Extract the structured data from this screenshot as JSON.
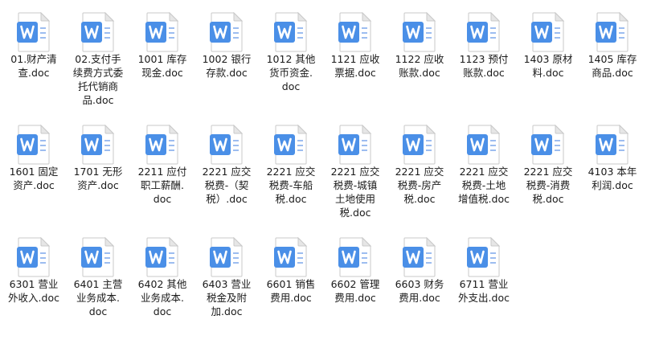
{
  "files": [
    {
      "line1": "01.财产清",
      "line2": "查.doc",
      "line3": ""
    },
    {
      "line1": "02.支付手",
      "line2": "续费方式委",
      "line3": "托代销商",
      "line4": "品.doc"
    },
    {
      "line1": "1001 库存",
      "line2": "现金.doc",
      "line3": ""
    },
    {
      "line1": "1002 银行",
      "line2": "存款.doc",
      "line3": ""
    },
    {
      "line1": "1012 其他",
      "line2": "货币资金.",
      "line3": "doc"
    },
    {
      "line1": "1121 应收",
      "line2": "票据.doc",
      "line3": ""
    },
    {
      "line1": "1122 应收",
      "line2": "账款.doc",
      "line3": ""
    },
    {
      "line1": "1123 预付",
      "line2": "账款.doc",
      "line3": ""
    },
    {
      "line1": "1403 原材",
      "line2": "料.doc",
      "line3": ""
    },
    {
      "line1": "1405 库存",
      "line2": "商品.doc",
      "line3": ""
    },
    {
      "line1": "1601 固定",
      "line2": "资产.doc",
      "line3": ""
    },
    {
      "line1": "1701 无形",
      "line2": "资产.doc",
      "line3": ""
    },
    {
      "line1": "2211 应付",
      "line2": "职工薪酬.",
      "line3": "doc"
    },
    {
      "line1": "2221 应交",
      "line2": "税费-（契",
      "line3": "税）.doc"
    },
    {
      "line1": "2221 应交",
      "line2": "税费-车船",
      "line3": "税.doc"
    },
    {
      "line1": "2221 应交",
      "line2": "税费-城镇",
      "line3": "土地使用",
      "line4": "税.doc"
    },
    {
      "line1": "2221 应交",
      "line2": "税费-房产",
      "line3": "税.doc"
    },
    {
      "line1": "2221 应交",
      "line2": "税费-土地",
      "line3": "增值税.doc"
    },
    {
      "line1": "2221 应交",
      "line2": "税费-消费",
      "line3": "税.doc"
    },
    {
      "line1": "4103 本年",
      "line2": "利润.doc",
      "line3": ""
    },
    {
      "line1": "6301 营业",
      "line2": "外收入.doc",
      "line3": ""
    },
    {
      "line1": "6401 主营",
      "line2": "业务成本.",
      "line3": "doc"
    },
    {
      "line1": "6402  其他",
      "line2": "业务成本.",
      "line3": "doc"
    },
    {
      "line1": "6403 营业",
      "line2": "税金及附",
      "line3": "加.doc"
    },
    {
      "line1": "6601 销售",
      "line2": "费用.doc",
      "line3": ""
    },
    {
      "line1": "6602 管理",
      "line2": "费用.doc",
      "line3": ""
    },
    {
      "line1": "6603 财务",
      "line2": "费用.doc",
      "line3": ""
    },
    {
      "line1": "6711 营业",
      "line2": "外支出.doc",
      "line3": ""
    }
  ],
  "icon": {
    "name": "word-document-icon",
    "badge_letter": "W",
    "badge_color": "#4a8fe7",
    "page_color": "#ffffff",
    "page_border": "#c9c9c9",
    "fold_color": "#e6e6e6"
  }
}
